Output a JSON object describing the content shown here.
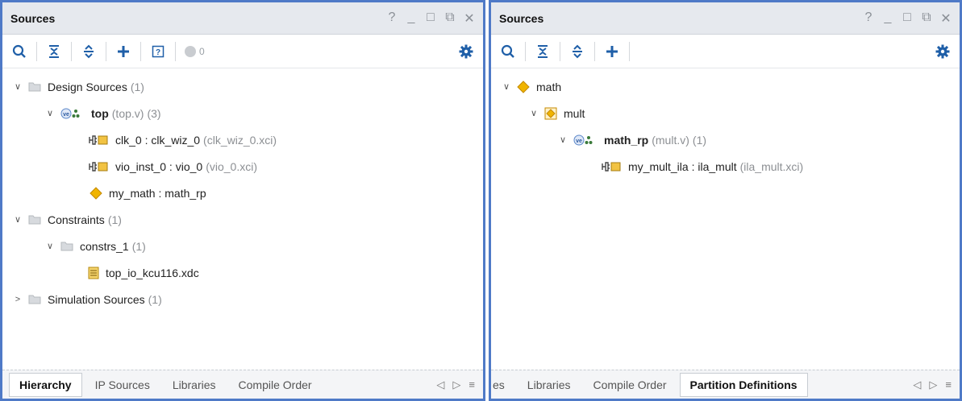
{
  "left_panel": {
    "title": "Sources",
    "controls": [
      "?",
      "_",
      "□",
      "⧉",
      "✕"
    ],
    "toolbar": {
      "badge_count": "0"
    },
    "tree": {
      "design_sources": {
        "label": "Design Sources",
        "count": "(1)"
      },
      "top": {
        "name": "top",
        "file": "(top.v)",
        "count": "(3)"
      },
      "clk": {
        "name": "clk_0 : clk_wiz_0",
        "file": "(clk_wiz_0.xci)"
      },
      "vio": {
        "name": "vio_inst_0 : vio_0",
        "file": "(vio_0.xci)"
      },
      "my_math": {
        "name": "my_math : math_rp"
      },
      "constraints": {
        "label": "Constraints",
        "count": "(1)"
      },
      "constrs": {
        "label": "constrs_1",
        "count": "(1)"
      },
      "xdc": {
        "name": "top_io_kcu116.xdc"
      },
      "sim": {
        "label": "Simulation Sources",
        "count": "(1)"
      }
    },
    "tabs": [
      "Hierarchy",
      "IP Sources",
      "Libraries",
      "Compile Order"
    ]
  },
  "right_panel": {
    "title": "Sources",
    "controls": [
      "?",
      "_",
      "□",
      "⧉",
      "✕"
    ],
    "tree": {
      "math": {
        "name": "math"
      },
      "mult": {
        "name": "mult"
      },
      "math_rp": {
        "name": "math_rp",
        "file": "(mult.v)",
        "count": "(1)"
      },
      "ila": {
        "name": "my_mult_ila : ila_mult",
        "file": "(ila_mult.xci)"
      }
    },
    "tabs": [
      "es",
      "Libraries",
      "Compile Order",
      "Partition Definitions"
    ]
  },
  "colors": {
    "accent": "#4f7ac7",
    "diamond": "#f0b400",
    "ip_box": "#f2c343",
    "muted": "#8c8f93"
  }
}
